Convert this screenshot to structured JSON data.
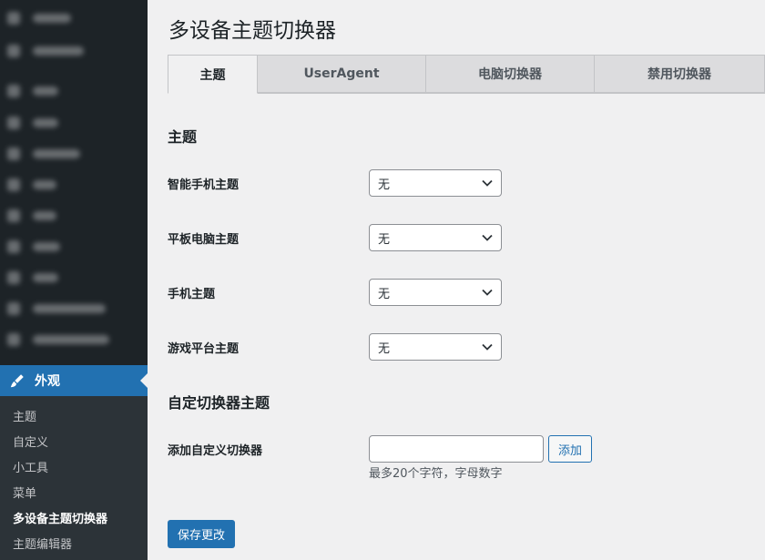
{
  "sidebar": {
    "active_menu": "外观",
    "submenu": [
      "主题",
      "自定义",
      "小工具",
      "菜单",
      "多设备主题切换器",
      "主题编辑器"
    ],
    "current_submenu": "多设备主题切换器"
  },
  "page": {
    "title": "多设备主题切换器"
  },
  "tabs": [
    "主题",
    "UserAgent",
    "电脑切换器",
    "禁用切换器"
  ],
  "active_tab": "主题",
  "section_themes": {
    "title": "主题",
    "fields": [
      {
        "label": "智能手机主题",
        "value": "无"
      },
      {
        "label": "平板电脑主题",
        "value": "无"
      },
      {
        "label": "手机主题",
        "value": "无"
      },
      {
        "label": "游戏平台主题",
        "value": "无"
      }
    ]
  },
  "section_custom": {
    "title": "自定切换器主题",
    "field_label": "添加自定义切换器",
    "input_value": "",
    "add_label": "添加",
    "hint": "最多20个字符，字母数字"
  },
  "save_label": "保存更改",
  "colors": {
    "accent": "#2271b1",
    "sidebar_bg": "#1d2327",
    "submenu_bg": "#2c3338",
    "page_bg": "#f0f0f1"
  }
}
